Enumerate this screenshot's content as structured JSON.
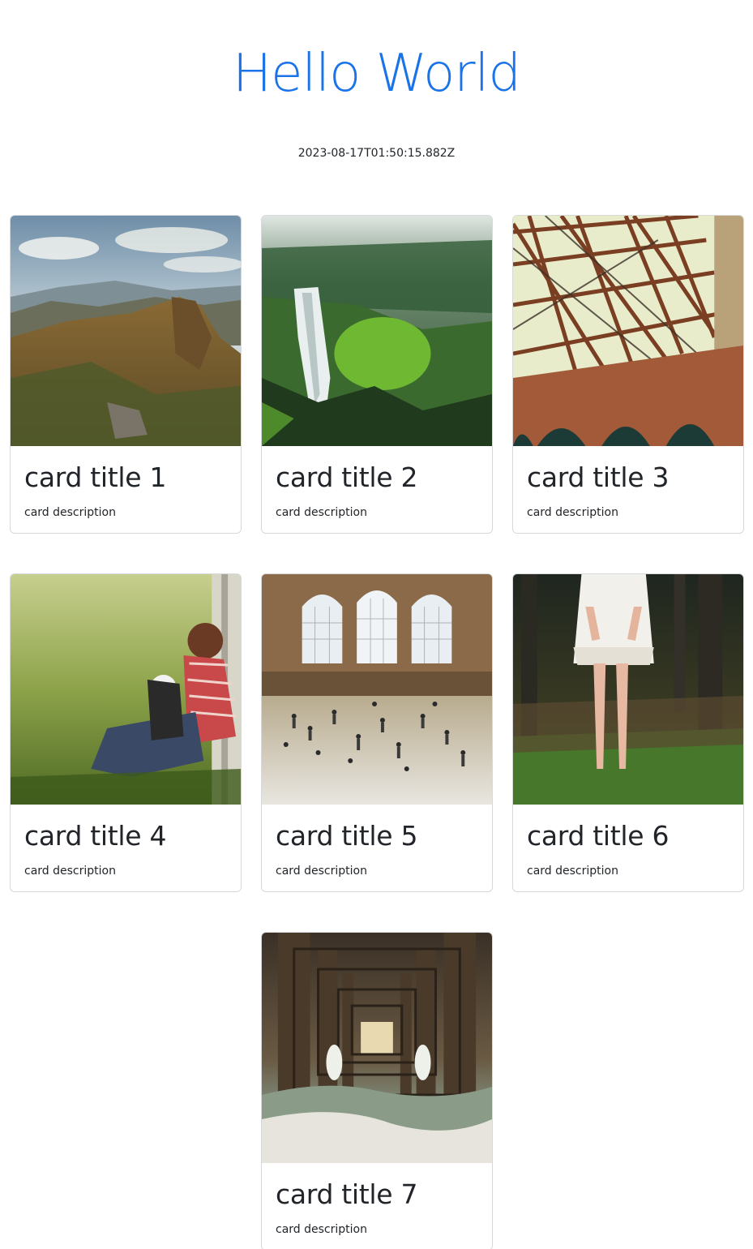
{
  "header": {
    "title": "Hello World",
    "timestamp": "2023-08-17T01:50:15.882Z"
  },
  "cards": [
    {
      "title": "card title 1",
      "description": "card description",
      "image": "mountain-landscape"
    },
    {
      "title": "card title 2",
      "description": "card description",
      "image": "waterfall-forest"
    },
    {
      "title": "card title 3",
      "description": "card description",
      "image": "bridge-steel-arch"
    },
    {
      "title": "card title 4",
      "description": "card description",
      "image": "man-with-dog-in-grass"
    },
    {
      "title": "card title 5",
      "description": "card description",
      "image": "train-station-crowd"
    },
    {
      "title": "card title 6",
      "description": "card description",
      "image": "woman-standing-in-forest"
    },
    {
      "title": "card title 7",
      "description": "card description",
      "image": "under-pier-waves"
    }
  ],
  "colors": {
    "title_blue": "#1a73e8",
    "text": "#212529",
    "card_border": "#d6d8db"
  }
}
